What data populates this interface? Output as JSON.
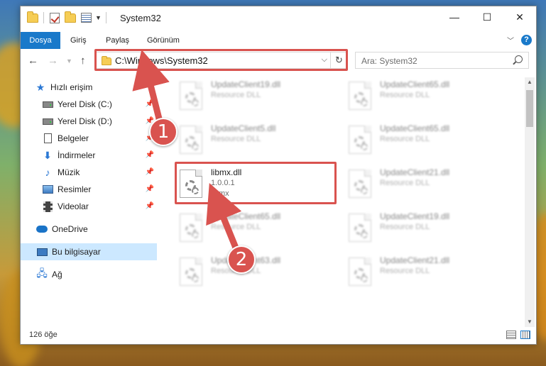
{
  "window": {
    "title": "System32",
    "controls": {
      "minimize": "—",
      "maximize": "☐",
      "close": "✕"
    }
  },
  "ribbon": {
    "tabs": [
      "Dosya",
      "Giriş",
      "Paylaş",
      "Görünüm"
    ],
    "help": "?"
  },
  "navigation": {
    "address": "C:\\Windows\\System32",
    "search_placeholder": "Ara: System32"
  },
  "sidebar": {
    "items": [
      {
        "label": "Hızlı erişim",
        "icon": "star-icon"
      },
      {
        "label": "Yerel Disk (C:)",
        "icon": "disk-icon",
        "pinned": true
      },
      {
        "label": "Yerel Disk (D:)",
        "icon": "disk-icon",
        "pinned": true
      },
      {
        "label": "Belgeler",
        "icon": "document-icon",
        "pinned": true
      },
      {
        "label": "İndirmeler",
        "icon": "download-icon",
        "pinned": true
      },
      {
        "label": "Müzik",
        "icon": "music-icon",
        "pinned": true
      },
      {
        "label": "Resimler",
        "icon": "pictures-icon",
        "pinned": true
      },
      {
        "label": "Videolar",
        "icon": "videos-icon",
        "pinned": true
      },
      {
        "label": "OneDrive",
        "icon": "cloud-icon"
      },
      {
        "label": "Bu bilgisayar",
        "icon": "computer-icon",
        "selected": true
      },
      {
        "label": "Ağ",
        "icon": "network-icon"
      }
    ]
  },
  "files": [
    {
      "name": "UpdateClient19.dll",
      "line2": "Resource DLL",
      "line3": "",
      "blurred": true
    },
    {
      "name": "UpdateClient65.dll",
      "line2": "Resource DLL",
      "line3": "",
      "blurred": true
    },
    {
      "name": "UpdateClient5.dll",
      "line2": "Resource DLL",
      "line3": "",
      "blurred": true
    },
    {
      "name": "UpdateClient65.dll",
      "line2": "Resource DLL",
      "line3": "",
      "blurred": true
    },
    {
      "name": "libmx.dll",
      "line2": "1.0.0.1",
      "line3": "libmx",
      "blurred": false
    },
    {
      "name": "UpdateClient21.dll",
      "line2": "Resource DLL",
      "line3": "",
      "blurred": true
    },
    {
      "name": "UpdateClient65.dll",
      "line2": "Resource DLL",
      "line3": "",
      "blurred": true
    },
    {
      "name": "UpdateClient19.dll",
      "line2": "Resource DLL",
      "line3": "",
      "blurred": true
    },
    {
      "name": "UpdateClient63.dll",
      "line2": "Resource DLL",
      "line3": "",
      "blurred": true
    },
    {
      "name": "UpdateClient21.dll",
      "line2": "Resource DLL",
      "line3": "",
      "blurred": true
    }
  ],
  "status": {
    "count": "126 öğe"
  },
  "annotations": {
    "step1": "1",
    "step2": "2",
    "color": "#d9534f"
  }
}
